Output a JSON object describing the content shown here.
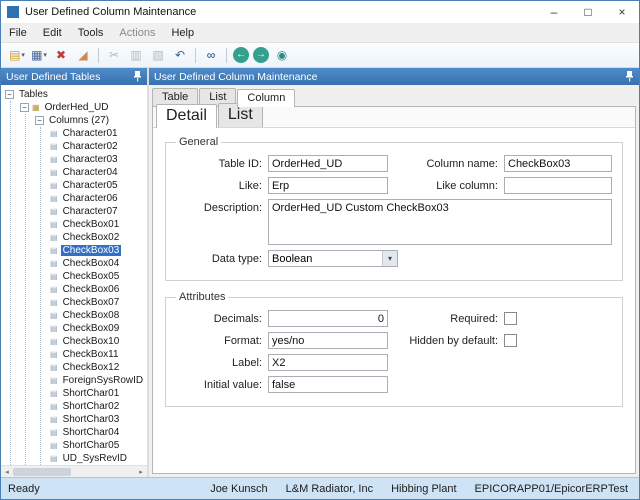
{
  "colors": {
    "panel_header_blue": "#3f7ec7",
    "selection_blue": "#3170c5",
    "status_bar_bg": "#cfe3f6",
    "delete_red": "#c23b3b",
    "nav_teal": "#35a08e"
  },
  "window": {
    "title": "User Defined Column Maintenance",
    "controls": {
      "minimize": "–",
      "maximize": "□",
      "close": "×"
    }
  },
  "menu": {
    "items": [
      {
        "label": "File",
        "name": "menu-file"
      },
      {
        "label": "Edit",
        "name": "menu-edit"
      },
      {
        "label": "Tools",
        "name": "menu-tools"
      },
      {
        "label": "Actions",
        "name": "menu-actions",
        "cls": "dim"
      },
      {
        "label": "Help",
        "name": "menu-help"
      }
    ]
  },
  "toolbar": {
    "buttons": [
      {
        "name": "new-button",
        "icon": "new-document-icon",
        "glyph": "▤",
        "cls": "c-amber",
        "caret": "▾"
      },
      {
        "name": "save-button",
        "icon": "save-icon",
        "glyph": "▦",
        "cls": "c-blue",
        "caret": "▾"
      },
      {
        "name": "delete-button",
        "icon": "delete-x-icon",
        "glyph": "✖",
        "cls": "c-red"
      },
      {
        "name": "clear-button",
        "icon": "eraser-icon",
        "glyph": "◢",
        "cls": "c-orange"
      },
      {
        "cls": "sep"
      },
      {
        "name": "cut-button",
        "icon": "scissors-icon",
        "glyph": "✂",
        "cls": "dim"
      },
      {
        "name": "copy-button",
        "icon": "copy-icon",
        "glyph": "▥",
        "cls": "dim"
      },
      {
        "name": "paste-button",
        "icon": "paste-icon",
        "glyph": "▧",
        "cls": "dim"
      },
      {
        "name": "undo-button",
        "icon": "undo-arrow-icon",
        "glyph": "↶",
        "cls": "c-blue"
      },
      {
        "cls": "sep"
      },
      {
        "name": "search-button",
        "icon": "binoculars-icon",
        "glyph": "∞",
        "cls": "c-navy"
      },
      {
        "cls": "sep"
      },
      {
        "name": "back-button",
        "icon": "arrow-left-icon",
        "glyph": "←",
        "cls": "circle"
      },
      {
        "name": "forward-button",
        "icon": "arrow-right-icon",
        "glyph": "→",
        "cls": "circle"
      },
      {
        "name": "target-button",
        "icon": "target-icon",
        "glyph": "◉",
        "cls": "c-teal"
      }
    ]
  },
  "tree_panel": {
    "header": "User Defined Tables",
    "root": "Tables",
    "table_node": "OrderHed_UD",
    "columns_node": "Columns (27)",
    "selected": "CheckBox03",
    "columns": [
      "Character01",
      "Character02",
      "Character03",
      "Character04",
      "Character05",
      "Character06",
      "Character07",
      "CheckBox01",
      "CheckBox02",
      "CheckBox03",
      "CheckBox04",
      "CheckBox05",
      "CheckBox06",
      "CheckBox07",
      "CheckBox08",
      "CheckBox09",
      "CheckBox10",
      "CheckBox11",
      "CheckBox12",
      "ForeignSysRowID",
      "ShortChar01",
      "ShortChar02",
      "ShortChar03",
      "ShortChar04",
      "ShortChar05",
      "UD_SysRevID"
    ]
  },
  "main_panel": {
    "header": "User Defined Column Maintenance",
    "tabs": [
      {
        "label": "Table",
        "name": "tab-table"
      },
      {
        "label": "List",
        "name": "tab-list"
      },
      {
        "label": "Column",
        "name": "tab-column",
        "cls": "selected"
      }
    ],
    "subtabs": [
      {
        "label": "Detail",
        "name": "tab-detail",
        "cls": "selected"
      },
      {
        "label": "List",
        "name": "tab-column-list"
      }
    ],
    "general": {
      "legend": "General",
      "fields": {
        "table_id": {
          "label": "Table ID:",
          "value": "OrderHed_UD"
        },
        "column_name": {
          "label": "Column name:",
          "value": "CheckBox03"
        },
        "like": {
          "label": "Like:",
          "value": "Erp"
        },
        "like_column": {
          "label": "Like column:",
          "value": ""
        },
        "description": {
          "label": "Description:",
          "value": "OrderHed_UD Custom CheckBox03"
        },
        "data_type": {
          "label": "Data type:",
          "value": "Boolean"
        }
      }
    },
    "attributes": {
      "legend": "Attributes",
      "fields": {
        "decimals": {
          "label": "Decimals:",
          "value": "0"
        },
        "format": {
          "label": "Format:",
          "value": "yes/no"
        },
        "label": {
          "label": "Label:",
          "value": "X2"
        },
        "initial_value": {
          "label": "Initial value:",
          "value": "false"
        },
        "required": {
          "label": "Required:",
          "checked": false
        },
        "hidden_by_default": {
          "label": "Hidden by default:",
          "checked": false
        }
      }
    }
  },
  "status_bar": {
    "left": "Ready",
    "items": [
      "Joe Kunsch",
      "L&M Radiator, Inc",
      "Hibbing Plant",
      "EPICORAPP01/EpicorERPTest"
    ]
  }
}
